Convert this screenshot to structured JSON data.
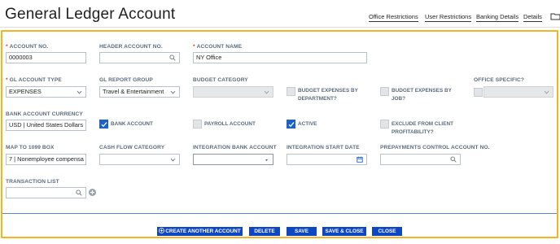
{
  "header": {
    "title": "General Ledger Account",
    "tabs": [
      {
        "label": "Office Restrictions"
      },
      {
        "label": "User Restrictions"
      },
      {
        "label": "Banking Details"
      },
      {
        "label": "Details"
      }
    ]
  },
  "form": {
    "account_no": {
      "label": "ACCOUNT NO.",
      "required": true,
      "value": "0000003"
    },
    "header_account_no": {
      "label": "HEADER ACCOUNT NO.",
      "value": ""
    },
    "account_name": {
      "label": "ACCOUNT NAME",
      "required": true,
      "value": "NY Office"
    },
    "gl_account_type": {
      "label": "GL ACCOUNT TYPE",
      "required": true,
      "value": "EXPENSES"
    },
    "gl_report_group": {
      "label": "GL REPORT GROUP",
      "value": "Travel & Entertainment"
    },
    "budget_category": {
      "label": "BUDGET CATEGORY",
      "value": "",
      "disabled": true
    },
    "budget_expenses_by_department": {
      "label_line1": "BUDGET EXPENSES BY",
      "label_line2": "DEPARTMENT?",
      "checked": false
    },
    "budget_expenses_by_job": {
      "label_line1": "BUDGET EXPENSES BY",
      "label_line2": "JOB?",
      "checked": false
    },
    "office_specific": {
      "label": "OFFICE SPECIFIC?",
      "checked": false,
      "value": ""
    },
    "bank_account_currency": {
      "label": "BANK ACCOUNT CURRENCY",
      "value": "USD | United States Dollars"
    },
    "bank_account": {
      "label": "BANK ACCOUNT",
      "checked": true
    },
    "payroll_account": {
      "label": "PAYROLL ACCOUNT",
      "checked": false
    },
    "active": {
      "label": "ACTIVE",
      "checked": true
    },
    "exclude_from_client_profitability": {
      "label_line1": "EXCLUDE FROM CLIENT",
      "label_line2": "PROFITABILITY?",
      "checked": false
    },
    "map_to_1099_box": {
      "label": "MAP TO 1099 BOX",
      "value": "7 | Nonemployee compensa"
    },
    "cash_flow_category": {
      "label": "CASH FLOW CATEGORY",
      "value": ""
    },
    "integration_bank_account": {
      "label": "INTEGRATION BANK ACCOUNT",
      "value": ""
    },
    "integration_start_date": {
      "label": "INTEGRATION START DATE",
      "value": ""
    },
    "prepayments_control_account_no": {
      "label": "PREPAYMENTS CONTROL ACCOUNT NO.",
      "value": ""
    },
    "transaction_list": {
      "label": "TRANSACTION LIST",
      "value": ""
    }
  },
  "buttons": {
    "create_another": "CREATE ANOTHER ACCOUNT",
    "delete": "DELETE",
    "save": "SAVE",
    "save_close": "SAVE & CLOSE",
    "close": "CLOSE"
  },
  "colors": {
    "panel_border": "#f3b324",
    "button_bg": "#0d47c4",
    "checkbox_checked": "#1d63c6",
    "required_star": "#d03a2b",
    "label_text": "#5b6b7d"
  },
  "icons": {
    "search": "magnifier-icon",
    "chevron": "chevron-down-icon",
    "calendar": "calendar-icon",
    "add": "plus-circle-icon",
    "folder": "folder-icon"
  }
}
